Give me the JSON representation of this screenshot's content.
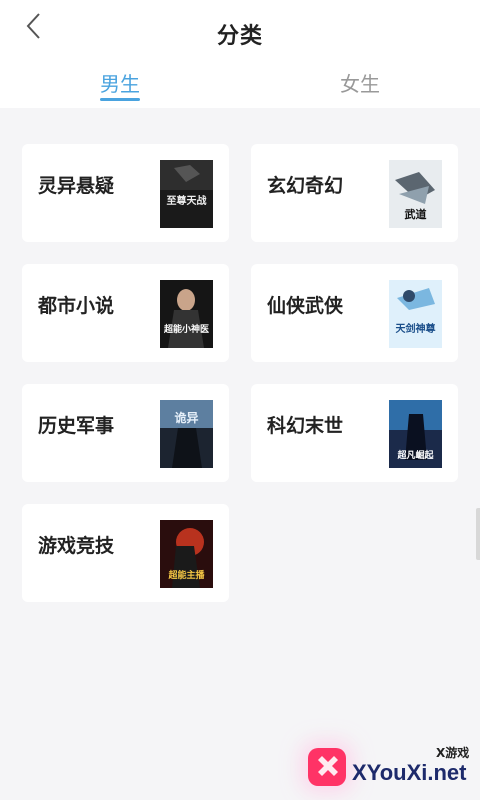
{
  "header": {
    "title": "分类",
    "back_icon": "chevron-left-icon"
  },
  "tabs": [
    {
      "label": "男生",
      "active": true
    },
    {
      "label": "女生",
      "active": false
    }
  ],
  "categories": [
    {
      "label": "灵异悬疑",
      "cover_text": "至尊天战"
    },
    {
      "label": "玄幻奇幻",
      "cover_text": "武道"
    },
    {
      "label": "都市小说",
      "cover_text": "超能小神医"
    },
    {
      "label": "仙侠武侠",
      "cover_text": "天剑神尊"
    },
    {
      "label": "历史军事",
      "cover_text": "诡异"
    },
    {
      "label": "科幻末世",
      "cover_text": "超凡崛起"
    },
    {
      "label": "游戏竞技",
      "cover_text": "超能主播"
    }
  ],
  "watermark": {
    "site": "XYouXi.net",
    "small": "X游戏"
  },
  "colors": {
    "accent": "#4aa3df",
    "background": "#f5f5f7",
    "card": "#ffffff"
  }
}
